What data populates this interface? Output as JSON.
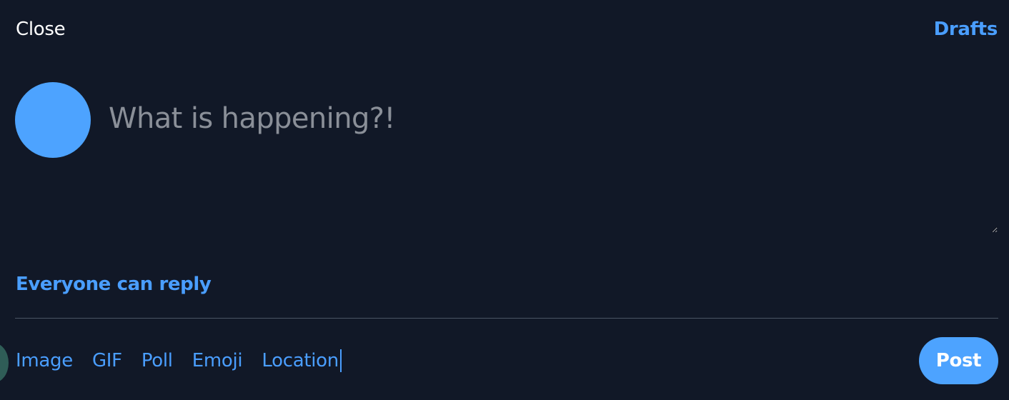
{
  "header": {
    "close_label": "Close",
    "drafts_label": "Drafts"
  },
  "compose": {
    "placeholder": "What is happening?!",
    "value": ""
  },
  "reply_setting_label": "Everyone can reply",
  "toolbar": {
    "image_label": "Image",
    "gif_label": "GIF",
    "poll_label": "Poll",
    "emoji_label": "Emoji",
    "location_label": "Location"
  },
  "post_button_label": "Post",
  "colors": {
    "background": "#111827",
    "accent": "#4a9eff",
    "avatar": "#4da3ff",
    "placeholder": "#8a8f98",
    "divider": "#4b5563"
  }
}
